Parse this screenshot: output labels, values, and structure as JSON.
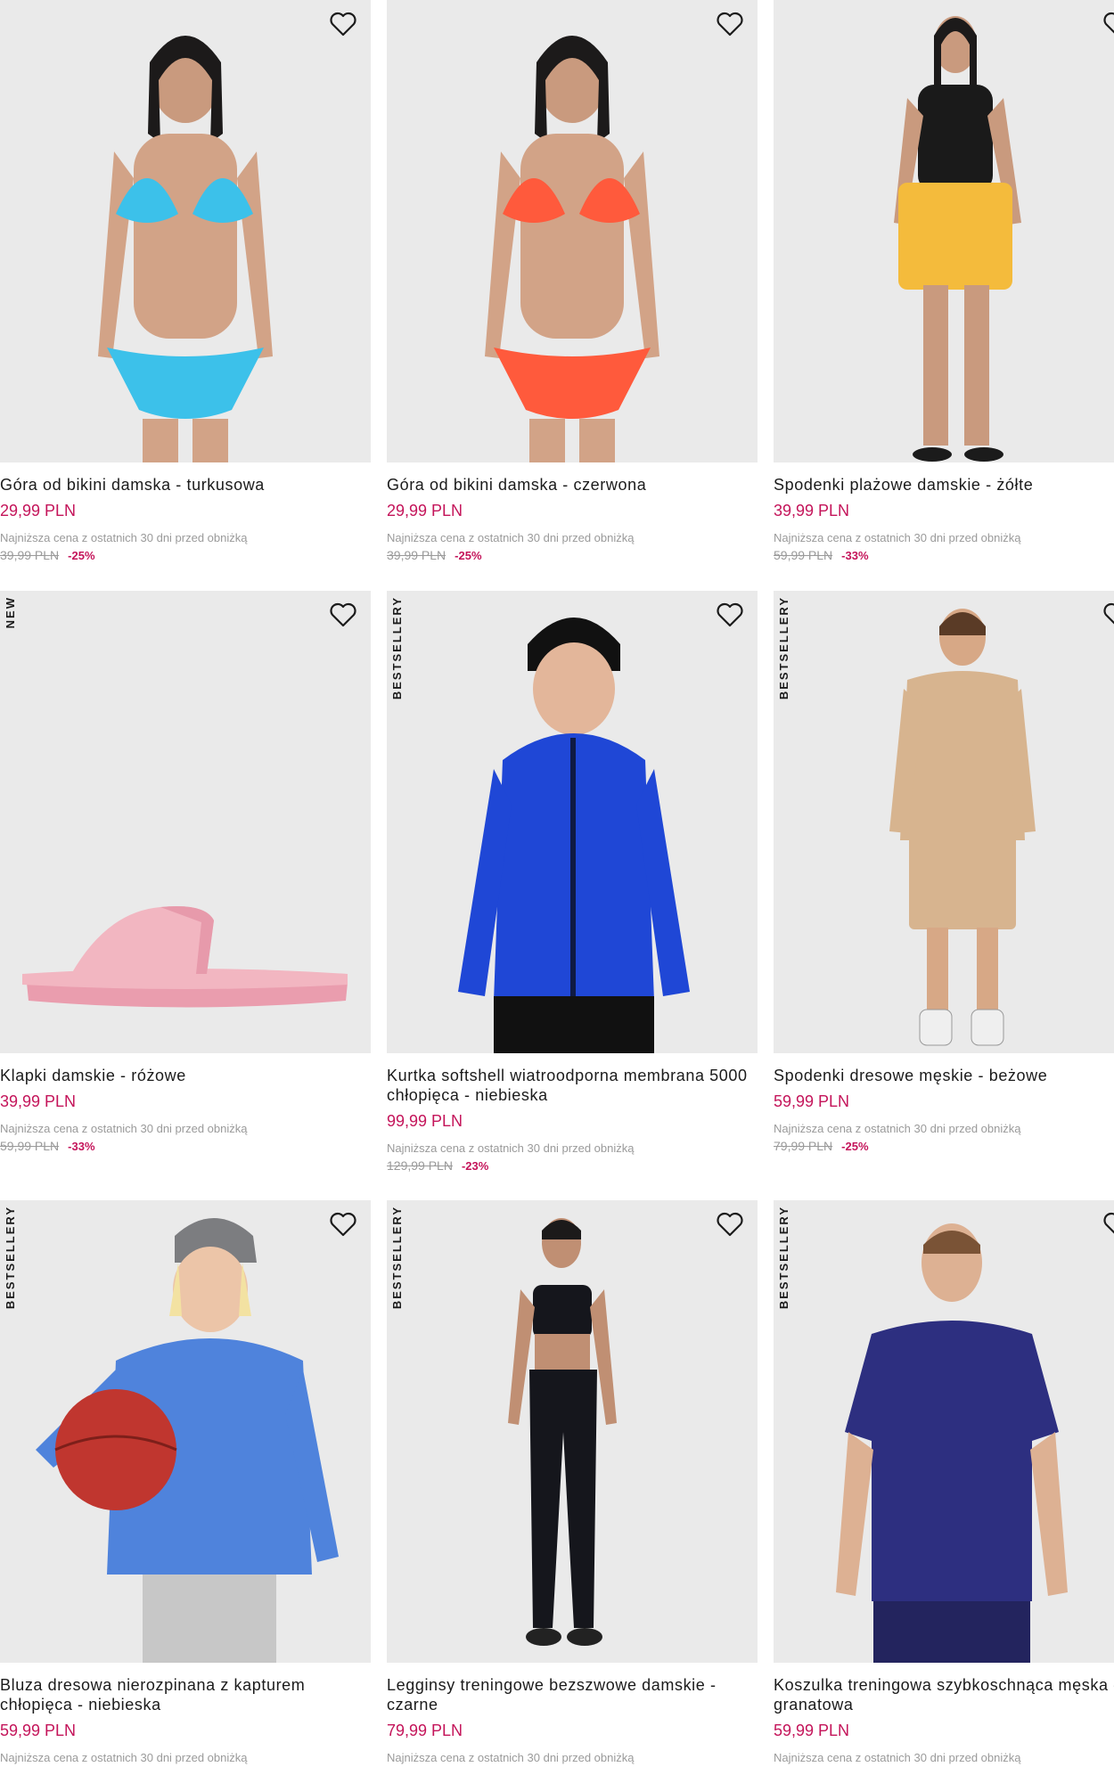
{
  "lowest_price_note": "Najniższa cena z ostatnich 30 dni przed obniżką",
  "products": [
    {
      "name": "Góra od bikini damska - turkusowa",
      "price": "29,99 PLN",
      "old_price": "39,99 PLN",
      "discount": "-25%",
      "badge": "",
      "color": "#3cc1ea"
    },
    {
      "name": "Góra od bikini damska - czerwona",
      "price": "29,99 PLN",
      "old_price": "39,99 PLN",
      "discount": "-25%",
      "badge": "",
      "color": "#ff5a3c"
    },
    {
      "name": "Spodenki plażowe damskie - żółte",
      "price": "39,99 PLN",
      "old_price": "59,99 PLN",
      "discount": "-33%",
      "badge": "",
      "color": "#f4bb3c"
    },
    {
      "name": "Klapki damskie - różowe",
      "price": "39,99 PLN",
      "old_price": "59,99 PLN",
      "discount": "-33%",
      "badge": "NEW",
      "color": "#f2b6c1"
    },
    {
      "name": "Kurtka softshell wiatroodporna membrana 5000 chłopięca - niebieska",
      "price": "99,99 PLN",
      "old_price": "129,99 PLN",
      "discount": "-23%",
      "badge": "BESTSELLERY",
      "color": "#1f47d6"
    },
    {
      "name": "Spodenki dresowe męskie - beżowe",
      "price": "59,99 PLN",
      "old_price": "79,99 PLN",
      "discount": "-25%",
      "badge": "BESTSELLERY",
      "color": "#d7b48f"
    },
    {
      "name": "Bluza dresowa nierozpinana z kapturem chłopięca - niebieska",
      "price": "59,99 PLN",
      "old_price": "",
      "discount": "",
      "badge": "BESTSELLERY",
      "color": "#4f83dc"
    },
    {
      "name": "Legginsy treningowe bezszwowe damskie - czarne",
      "price": "79,99 PLN",
      "old_price": "",
      "discount": "",
      "badge": "BESTSELLERY",
      "color": "#15161c"
    },
    {
      "name": "Koszulka treningowa szybkoschnąca męska - granatowa",
      "price": "59,99 PLN",
      "old_price": "",
      "discount": "",
      "badge": "BESTSELLERY",
      "color": "#2d2f80"
    }
  ],
  "icons": {
    "favorite": "heart-outline-icon"
  }
}
